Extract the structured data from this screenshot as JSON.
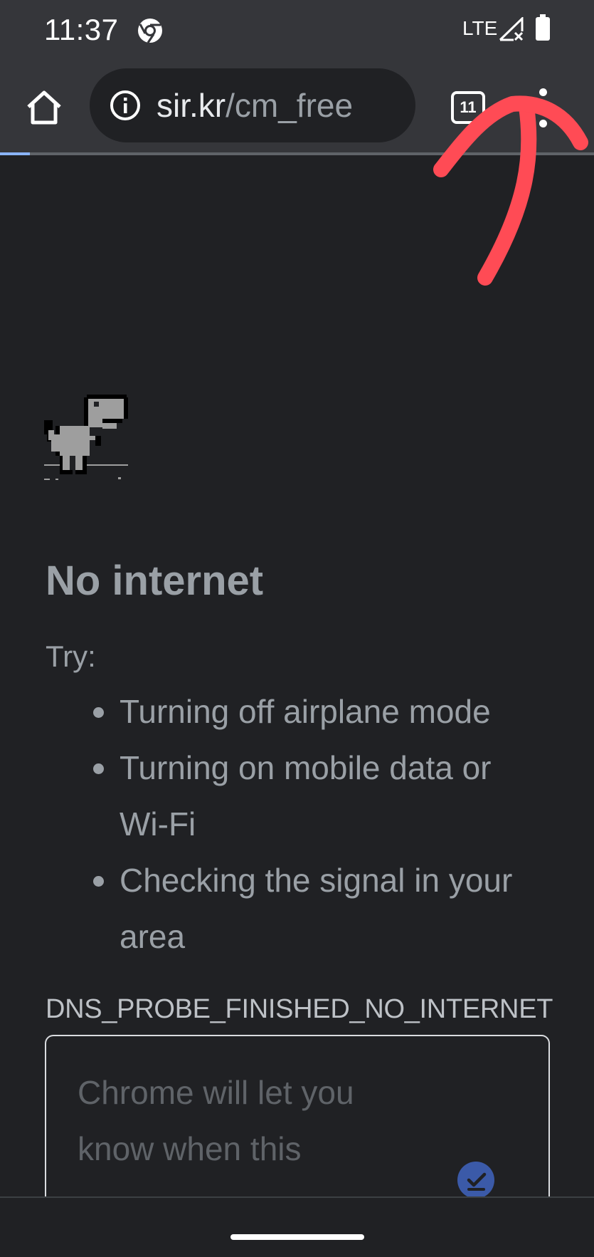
{
  "status_bar": {
    "time": "11:37",
    "network": "LTE"
  },
  "toolbar": {
    "url_host": "sir.kr",
    "url_path": "/cm_free",
    "tab_count": "11"
  },
  "page": {
    "heading": "No internet",
    "try_label": "Try:",
    "tips": [
      "Turning off airplane mode",
      "Turning on mobile data or Wi-Fi",
      "Checking the signal in your area"
    ],
    "error_code": "DNS_PROBE_FINISHED_NO_INTERNET",
    "notify_text": "Chrome will let you know when this"
  },
  "colors": {
    "background": "#202124",
    "toolbar": "#35363a",
    "text_muted": "#9aa0a6",
    "annotation": "#ff4b55",
    "progress": "#8ab4f8"
  },
  "icons": {
    "home": "home-icon",
    "info": "info-icon",
    "tabs": "tab-switcher-icon",
    "menu": "more-vert-icon",
    "dino": "offline-dino-icon"
  },
  "progress": 0.05
}
